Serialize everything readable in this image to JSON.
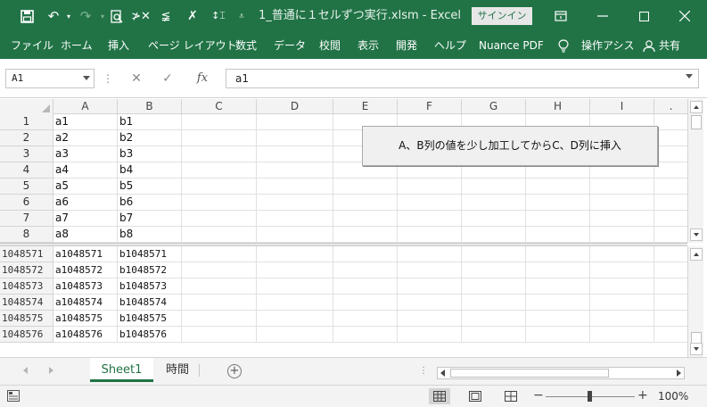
{
  "titlebar": {
    "title": "1_普通に１セルずつ実行.xlsm - Excel",
    "signin_label": "サインイン"
  },
  "ribbon": {
    "tabs": [
      {
        "label": "ファイル"
      },
      {
        "label": "ホーム"
      },
      {
        "label": "挿入"
      },
      {
        "label": "ページ レイアウト"
      },
      {
        "label": "数式"
      },
      {
        "label": "データ"
      },
      {
        "label": "校閲"
      },
      {
        "label": "表示"
      },
      {
        "label": "開発"
      },
      {
        "label": "ヘルプ"
      },
      {
        "label": "Nuance PDF"
      },
      {
        "label": "操作アシス"
      },
      {
        "label": "共有"
      }
    ]
  },
  "formula_bar": {
    "name_box": "A1",
    "formula": "a1"
  },
  "grid": {
    "columns": [
      "A",
      "B",
      "C",
      "D",
      "E",
      "F",
      "G",
      "H",
      "I"
    ],
    "top_rows": [
      {
        "num": "1",
        "a": "a1",
        "b": "b1"
      },
      {
        "num": "2",
        "a": "a2",
        "b": "b2"
      },
      {
        "num": "3",
        "a": "a3",
        "b": "b3"
      },
      {
        "num": "4",
        "a": "a4",
        "b": "b4"
      },
      {
        "num": "5",
        "a": "a5",
        "b": "b5"
      },
      {
        "num": "6",
        "a": "a6",
        "b": "b6"
      },
      {
        "num": "7",
        "a": "a7",
        "b": "b7"
      },
      {
        "num": "8",
        "a": "a8",
        "b": "b8"
      }
    ],
    "bottom_rows": [
      {
        "num": "1048571",
        "a": "a1048571",
        "b": "b1048571"
      },
      {
        "num": "1048572",
        "a": "a1048572",
        "b": "b1048572"
      },
      {
        "num": "1048573",
        "a": "a1048573",
        "b": "b1048573"
      },
      {
        "num": "1048574",
        "a": "a1048574",
        "b": "b1048574"
      },
      {
        "num": "1048575",
        "a": "a1048575",
        "b": "b1048575"
      },
      {
        "num": "1048576",
        "a": "a1048576",
        "b": "b1048576"
      }
    ]
  },
  "macro_button": {
    "label": "A、B列の値を少し加工してからC、D列に挿入"
  },
  "sheets": {
    "tabs": [
      {
        "label": "Sheet1",
        "active": true
      },
      {
        "label": "時間",
        "active": false
      }
    ]
  },
  "status": {
    "zoom": "100%"
  },
  "colors": {
    "accent": "#217346",
    "grid_line": "#e1e1e1",
    "header_bg": "#f3f3f3"
  }
}
